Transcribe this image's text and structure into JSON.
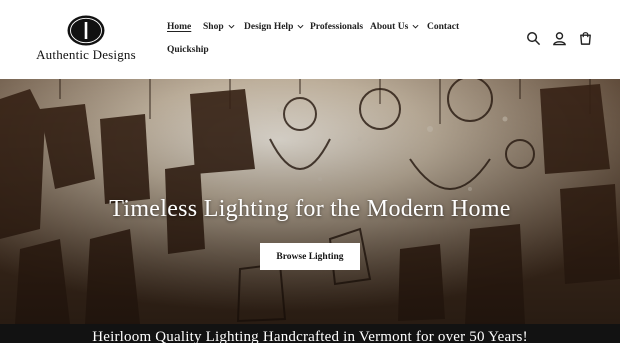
{
  "brand": {
    "name": "Authentic Designs"
  },
  "nav": {
    "items": [
      {
        "label": "Home",
        "active": true,
        "dropdown": false
      },
      {
        "label": "Shop",
        "active": false,
        "dropdown": true
      },
      {
        "label": "Design Help",
        "active": false,
        "dropdown": true
      },
      {
        "label": "Professionals",
        "active": false,
        "dropdown": false
      },
      {
        "label": "About Us",
        "active": false,
        "dropdown": true
      },
      {
        "label": "Contact",
        "active": false,
        "dropdown": false
      },
      {
        "label": "Quickship",
        "active": false,
        "dropdown": false
      }
    ]
  },
  "header_icons": [
    "search-icon",
    "account-icon",
    "cart-icon"
  ],
  "hero": {
    "title": "Timeless Lighting for the Modern Home",
    "button_label": "Browse Lighting"
  },
  "banner": {
    "text": "Heirloom Quality Lighting Handcrafted in Vermont for over 50 Years!"
  },
  "colors": {
    "header_bg": "#ffffff",
    "text": "#121212",
    "banner_bg": "#121212",
    "button_bg": "#ffffff"
  }
}
